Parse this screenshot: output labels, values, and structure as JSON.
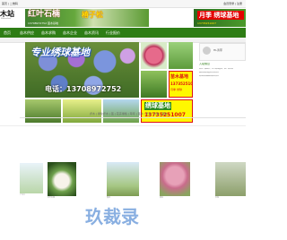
{
  "topbar": {
    "left_text": "首页 | 二维码",
    "right_text": "会员登录 | 注册"
  },
  "header": {
    "logo_text": "木站",
    "logo_sub": "Mumuzhan",
    "banner_left": {
      "title": "红叶石楠",
      "highlight": "椿子松",
      "subtitle": "13708972752 苗木基地"
    },
    "banner_right": {
      "title": "月季 绣球基地",
      "subtitle": "13735251007"
    }
  },
  "nav": {
    "items": [
      "首页",
      "苗木供应",
      "苗木求购",
      "苗木企业",
      "苗木资讯",
      "行业报价"
    ]
  },
  "hero": {
    "title": "专业绣球基地",
    "phone": "电话：13708972752"
  },
  "ad_small": {
    "line1": "苗木基地",
    "line2": "13735251007",
    "line3": "月季 绣球"
  },
  "ad_wide": {
    "title": "绣球基地",
    "phone": "13735251007"
  },
  "profile": {
    "username": "HL清带"
  },
  "info_lines": [
    "入驻信息",
    "苗木产品服务，求工绣球基地，推广苗木苗",
    "品牌苗绣球基地供应信息",
    "绣球苗苗圃采购联系信息"
  ],
  "filters": [
    "乔木 | 绿化乔木 | 苗 | 花卉绿植 | 草坪 | 苗木 | 景观 | 竹类 | 其他"
  ],
  "products": [
    {
      "name": "广玉兰",
      "price": "¥0.00"
    },
    {
      "name": "红叶石楠",
      "price": "¥0.00"
    },
    {
      "name": "樱花",
      "price": "¥0.00"
    },
    {
      "name": "银杏",
      "price": "¥0.00"
    },
    {
      "name": "红梅",
      "price": "¥0.00"
    }
  ],
  "watermark": "玖裁录"
}
